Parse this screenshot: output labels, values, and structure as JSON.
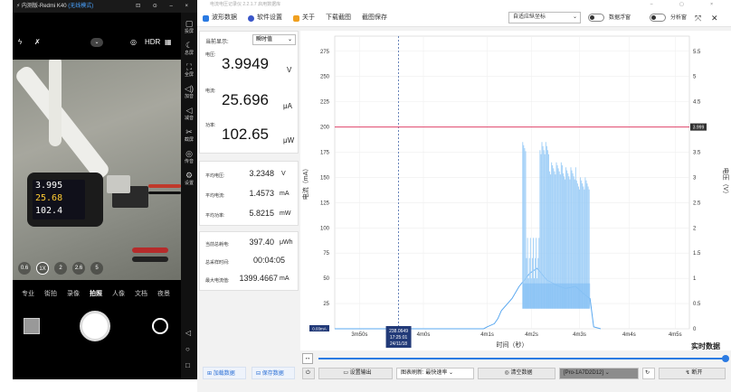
{
  "phone": {
    "title": "内测版-Redmi K40",
    "wireless": "(无线模式)",
    "hdr": "HDR",
    "device_screen": [
      "3.995",
      "25.68",
      "102.4"
    ],
    "zoom_options": [
      "0.6",
      "1X",
      "2",
      "2.6",
      "5"
    ],
    "modes": [
      "专业",
      "街拍",
      "录像",
      "拍照",
      "人像",
      "文档",
      "夜景"
    ],
    "active_mode": "拍照",
    "side_items": [
      {
        "icon": "screen-icon",
        "label": "投屏"
      },
      {
        "icon": "sleep-icon",
        "label": "息屏"
      },
      {
        "icon": "fullscreen-icon",
        "label": "全屏"
      },
      {
        "icon": "volume-up-icon",
        "label": "加音"
      },
      {
        "icon": "volume-down-icon",
        "label": "减音"
      },
      {
        "icon": "screenshot-icon",
        "label": "截屏"
      },
      {
        "icon": "rotate-icon",
        "label": "传音"
      },
      {
        "icon": "settings-icon",
        "label": "设置"
      }
    ]
  },
  "app": {
    "title": "电流电压记录仪    2.2.1.7  启用数据库",
    "menu": [
      {
        "label": "波形数据",
        "color": "#2a7ae2"
      },
      {
        "label": "软件设置",
        "color": "#3a56c9"
      },
      {
        "label": "关于",
        "color": "#f0a020"
      },
      {
        "label": "下载截图",
        "color": ""
      },
      {
        "label": "截图保存",
        "color": ""
      }
    ],
    "axis_mode": "自适应纵坐标",
    "data_float_label": "数据浮窗",
    "analysis_label": "分析窗",
    "readings": {
      "display_label": "当前显示:",
      "display_value": "瞬时值",
      "voltage_label": "电压:",
      "voltage": "3.9949",
      "voltage_unit": "V",
      "current_label": "电流:",
      "current": "25.696",
      "current_unit": "μA",
      "power_label": "功率:",
      "power": "102.65",
      "power_unit": "μW",
      "avg_voltage_label": "平均电压:",
      "avg_voltage": "3.2348",
      "avg_voltage_unit": "V",
      "avg_current_label": "平均电流:",
      "avg_current": "1.4573",
      "avg_current_unit": "mA",
      "avg_power_label": "平均功率:",
      "avg_power": "5.8215",
      "avg_power_unit": "mW",
      "total_energy_label": "当前总耗电:",
      "total_energy": "397.40",
      "total_energy_unit": "μWh",
      "total_time_label": "总采样时间:",
      "total_time": "00:04:05",
      "max_current_label": "最大电流值:",
      "max_current": "1399.4667",
      "max_current_unit": "mA",
      "load_button": "加载数据",
      "save_button": "保存数据"
    },
    "chart_labels": {
      "cursor_value": "238.0649",
      "cursor_time": "17:25:01",
      "cursor_date": "24/11/18",
      "current_marker": "0.03mA",
      "voltage_marker": "3.999",
      "realtime": "实时数据"
    },
    "bottom": {
      "output_button": "设置输出",
      "refresh_label": "图表刷新: 最快速率",
      "clear_button": "清空数据",
      "device": "[Pro-1A7D2D12]",
      "refresh_button": "断开"
    }
  },
  "chart_data": {
    "type": "line",
    "xlabel": "时间（秒）",
    "ylabel_left": "电流（mA）",
    "ylabel_right": "电压（V）",
    "x_ticks": [
      "3m50s",
      "4m0s",
      "4m1s",
      "4m2s",
      "4m3s",
      "4m4s",
      "4m5s"
    ],
    "y_left_ticks": [
      0,
      25,
      50,
      75,
      100,
      125,
      150,
      175,
      200,
      225,
      250,
      275
    ],
    "y_right_ticks": [
      0,
      0.5,
      1,
      1.5,
      2,
      2.5,
      3,
      3.5,
      4,
      4.5,
      5,
      5.5
    ],
    "ylim_left": [
      0,
      290
    ],
    "ylim_right": [
      0,
      5.8
    ],
    "grid": true,
    "series": [
      {
        "name": "电压",
        "color": "#e0436a",
        "axis": "right",
        "x": [
          0,
          1
        ],
        "y": [
          3.999,
          3.999
        ]
      },
      {
        "name": "电流",
        "color": "#6fb8f5",
        "axis": "left",
        "x": [
          0.0,
          0.1,
          0.3,
          0.4,
          0.42,
          0.43,
          0.45,
          0.46,
          0.47,
          0.5,
          0.52,
          0.55,
          0.57,
          0.6,
          0.62,
          0.65,
          0.68,
          0.7,
          0.72,
          0.73,
          0.75
        ],
        "y": [
          0,
          0,
          0,
          0,
          0.03,
          2,
          5,
          10,
          18,
          30,
          42,
          55,
          60,
          48,
          44,
          40,
          42,
          35,
          30,
          2,
          0
        ],
        "peaks": [
          185,
          175,
          165,
          160,
          150
        ]
      }
    ]
  }
}
